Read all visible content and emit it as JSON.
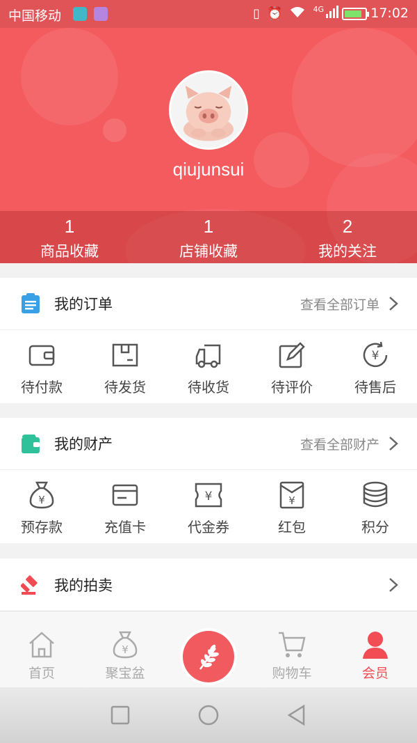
{
  "status_bar": {
    "carrier": "中国移动",
    "network": "4G",
    "time": "17:02"
  },
  "profile": {
    "username": "qiujunsui",
    "avatar": "pig-avatar"
  },
  "stats": [
    {
      "count": "1",
      "label": "商品收藏"
    },
    {
      "count": "1",
      "label": "店铺收藏"
    },
    {
      "count": "2",
      "label": "我的关注"
    }
  ],
  "orders": {
    "title": "我的订单",
    "link": "查看全部订单",
    "items": [
      {
        "label": "待付款",
        "icon": "wallet-icon"
      },
      {
        "label": "待发货",
        "icon": "box-icon"
      },
      {
        "label": "待收货",
        "icon": "truck-icon"
      },
      {
        "label": "待评价",
        "icon": "edit-icon"
      },
      {
        "label": "待售后",
        "icon": "refund-icon"
      }
    ]
  },
  "assets": {
    "title": "我的财产",
    "link": "查看全部财产",
    "items": [
      {
        "label": "预存款",
        "icon": "money-bag-icon"
      },
      {
        "label": "充值卡",
        "icon": "card-icon"
      },
      {
        "label": "代金券",
        "icon": "voucher-icon"
      },
      {
        "label": "红包",
        "icon": "red-envelope-icon"
      },
      {
        "label": "积分",
        "icon": "coins-icon"
      }
    ]
  },
  "auction": {
    "title": "我的拍卖"
  },
  "tabbar": [
    {
      "label": "首页",
      "icon": "home-icon",
      "active": false
    },
    {
      "label": "聚宝盆",
      "icon": "money-bag-icon",
      "active": false
    },
    {
      "label": "",
      "icon": "wheat-icon",
      "active": false
    },
    {
      "label": "购物车",
      "icon": "cart-icon",
      "active": false
    },
    {
      "label": "会员",
      "icon": "user-icon",
      "active": true
    }
  ],
  "colors": {
    "brand": "#f45b5f",
    "active_tab": "#f24d55"
  }
}
